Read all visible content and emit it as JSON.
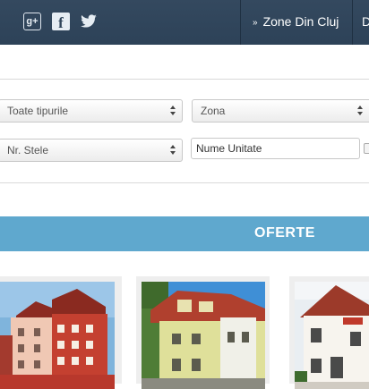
{
  "header": {
    "social": [
      {
        "name": "google-plus",
        "glyph": "g+"
      },
      {
        "name": "facebook",
        "glyph": "f"
      },
      {
        "name": "twitter"
      }
    ],
    "nav": {
      "zones_label": "Zone Din Cluj",
      "next_initial": "D"
    }
  },
  "search": {
    "type_select": "Toate tipurile",
    "zone_select": "Zona",
    "stars_select": "Nr. Stele",
    "unit_name_placeholder": "Nume Unitate"
  },
  "offers": {
    "title": "OFERTE",
    "items": [
      {
        "image": "hotel-photo-red-building"
      },
      {
        "image": "hotel-photo-yellow-villa"
      },
      {
        "image": "hotel-photo-white-house"
      }
    ]
  },
  "colors": {
    "header_bg": "#34495f",
    "offers_bar": "#5fa8ce"
  }
}
